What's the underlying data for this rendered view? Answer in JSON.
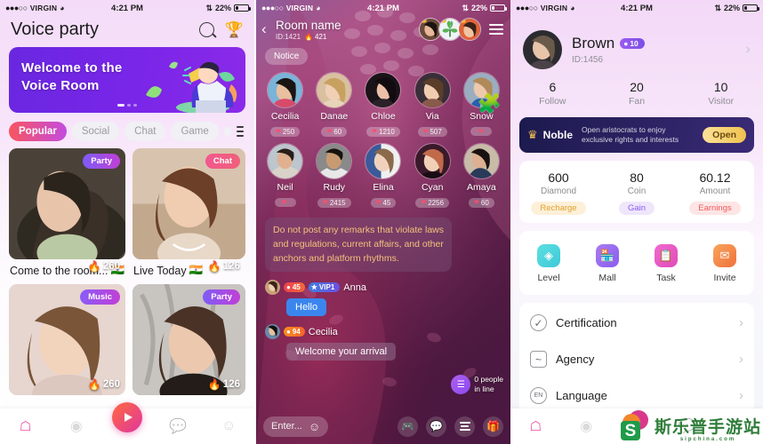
{
  "status_bar": {
    "dots": "●●●○○",
    "carrier": "VIRGIN",
    "wifi": "wifi-icon",
    "time": "4:21 PM",
    "bluetooth": "bluetooth-icon",
    "battery_pct": "22%"
  },
  "screen1": {
    "title": "Voice party",
    "search_icon": "search-icon",
    "trophy_icon": "trophy-icon",
    "banner": {
      "line1": "Welcome to the",
      "line2": "Voice Room"
    },
    "chips": [
      "Popular",
      "Social",
      "Chat",
      "Game"
    ],
    "active_chip": "Popular",
    "menu_icon": "hamburger-icon",
    "cards": [
      {
        "tag": "Party",
        "tag_type": "party",
        "hot": "260",
        "caption": "Come to the room...",
        "flag": "🇮🇳"
      },
      {
        "tag": "Chat",
        "tag_type": "chat",
        "hot": "126",
        "caption": "Live Today",
        "flag": "🇮🇳"
      },
      {
        "tag": "Music",
        "tag_type": "music",
        "hot": "260",
        "caption": "",
        "flag": ""
      },
      {
        "tag": "Party",
        "tag_type": "party",
        "hot": "126",
        "caption": "",
        "flag": ""
      }
    ],
    "tabs": [
      {
        "name": "home-tab",
        "glyph": "⌂",
        "active": true
      },
      {
        "name": "discover-tab",
        "glyph": "◎",
        "active": false
      },
      {
        "name": "live-tab",
        "glyph": "▶",
        "active": true
      },
      {
        "name": "message-tab",
        "glyph": "💬",
        "active": false
      },
      {
        "name": "profile-tab",
        "glyph": "☻",
        "active": false
      }
    ]
  },
  "screen2": {
    "back_icon": "back-chevron-icon",
    "room_name": "Room name",
    "room_id": "ID:1421",
    "room_hot": "421",
    "menu_icon": "hamburger-icon",
    "notice": "Notice",
    "seats_row1": [
      {
        "name": "Cecilia",
        "hearts": "250"
      },
      {
        "name": "Danae",
        "hearts": "60"
      },
      {
        "name": "Chloe",
        "hearts": "1210"
      },
      {
        "name": "Via",
        "hearts": "507"
      },
      {
        "name": "Snow",
        "hearts": ""
      }
    ],
    "seats_row2": [
      {
        "name": "Neil",
        "hearts": ""
      },
      {
        "name": "Rudy",
        "hearts": "2415"
      },
      {
        "name": "Elina",
        "hearts": "45"
      },
      {
        "name": "Cyan",
        "hearts": "2256"
      },
      {
        "name": "Amaya",
        "hearts": "60"
      }
    ],
    "system_message": "Do not post any remarks that violate laws and regulations, current affairs, and other anchors and platform rhythms.",
    "messages": [
      {
        "level": "45",
        "vip": "VIP1",
        "name": "Anna",
        "text": "Hello",
        "bubble": "blue"
      },
      {
        "level": "94",
        "vip": "",
        "name": "Cecilia",
        "text": "Welcome your arrival",
        "bubble": "grey"
      }
    ],
    "chest_icon": "treasure-chest-icon",
    "queue_count": "0 people",
    "queue_label": "in line",
    "input_placeholder": "Enter...",
    "emoji_icon": "emoji-icon",
    "bottom_icons": [
      "game-controller-icon",
      "chat-bubble-icon",
      "list-lines-icon",
      "gift-icon"
    ]
  },
  "screen3": {
    "avatar": "user-avatar",
    "name": "Brown",
    "level_badge": "10",
    "user_id": "ID:1456",
    "chevron_icon": "chevron-right-icon",
    "stats": [
      {
        "value": "6",
        "label": "Follow"
      },
      {
        "value": "20",
        "label": "Fan"
      },
      {
        "value": "10",
        "label": "Visitor"
      }
    ],
    "noble": {
      "crown_icon": "crown-icon",
      "title": "Noble",
      "desc_line1": "Open aristocrats to enjoy",
      "desc_line2": "exclusive rights and interests",
      "button": "Open"
    },
    "wallet": [
      {
        "value": "600",
        "label": "Diamond",
        "action": "Recharge",
        "style": "rec"
      },
      {
        "value": "80",
        "label": "Coin",
        "action": "Gain",
        "style": "gain"
      },
      {
        "value": "60.12",
        "label": "Amount",
        "action": "Earnings",
        "style": "earn"
      }
    ],
    "quick": [
      {
        "label": "Level",
        "icon": "level-icon",
        "style": "lv"
      },
      {
        "label": "Mall",
        "icon": "mall-icon",
        "style": "ml"
      },
      {
        "label": "Task",
        "icon": "task-icon",
        "style": "tk"
      },
      {
        "label": "Invite",
        "icon": "invite-icon",
        "style": "iv"
      }
    ],
    "rows": [
      {
        "label": "Certification",
        "icon": "certification-icon",
        "glyph": "✓"
      },
      {
        "label": "Agency",
        "icon": "agency-icon",
        "glyph": "~"
      },
      {
        "label": "Language",
        "icon": "language-icon",
        "glyph": "EN"
      }
    ]
  },
  "watermark": {
    "cn": "斯乐普手游站",
    "en": "sipchina.com"
  }
}
